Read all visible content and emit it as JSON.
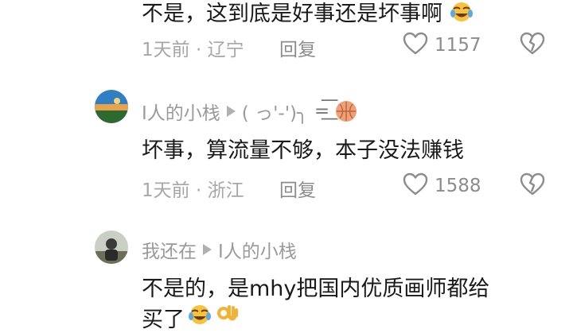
{
  "comments": [
    {
      "text": "不是，这到底是好事还是坏事啊",
      "time": "1天前",
      "sep": "·",
      "location": "辽宁",
      "reply_label": "回复",
      "likes": "1157",
      "emoji": "face-with-tears-of-joy"
    },
    {
      "author": "I人的小栈",
      "reply_to_kaomoji": "( っ'-')╮",
      "kaomoji_tail": "=͟͟͞͞",
      "text": "坏事，算流量不够，本子没法赚钱",
      "time": "1天前",
      "sep": "·",
      "location": "浙江",
      "reply_label": "回复",
      "likes": "1588",
      "emoji": "basketball"
    },
    {
      "author": "我还在",
      "reply_to": "I人的小栈",
      "text_line1": "不是的，是mhy把国内优质画师都给",
      "text_line2": "买了",
      "emoji": "face-with-tears-of-joy, ok-hand"
    }
  ],
  "colors": {
    "text": "#1a1a1a",
    "meta": "#a7a7a7",
    "icon": "#8c8c8c"
  }
}
